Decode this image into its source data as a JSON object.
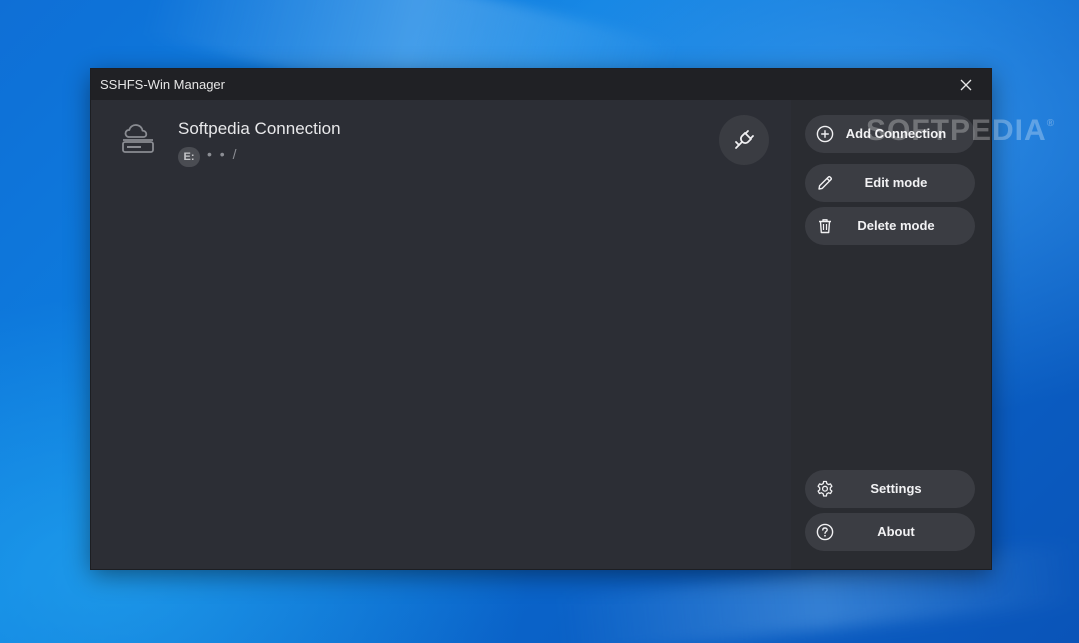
{
  "window": {
    "title": "SSHFS-Win Manager"
  },
  "connections": [
    {
      "name": "Softpedia Connection",
      "drive_letter": "E:",
      "path": "• • /",
      "icon": "cloud-server-icon",
      "action_icon": "plug-connect-icon"
    }
  ],
  "sidebar": {
    "buttons": [
      {
        "label": "Add Connection",
        "icon": "plus-circle-icon"
      },
      {
        "label": "Edit mode",
        "icon": "pencil-icon"
      },
      {
        "label": "Delete mode",
        "icon": "trash-icon"
      },
      {
        "label": "Settings",
        "icon": "gear-icon"
      },
      {
        "label": "About",
        "icon": "question-circle-icon"
      }
    ]
  },
  "watermark": {
    "text": "SOFTPEDIA",
    "mark": "®"
  },
  "colors": {
    "window_bg": "#2c2e35",
    "titlebar_bg": "#202125",
    "button_bg": "#3b3d43",
    "desktop_accent": "#0c7fe0"
  }
}
